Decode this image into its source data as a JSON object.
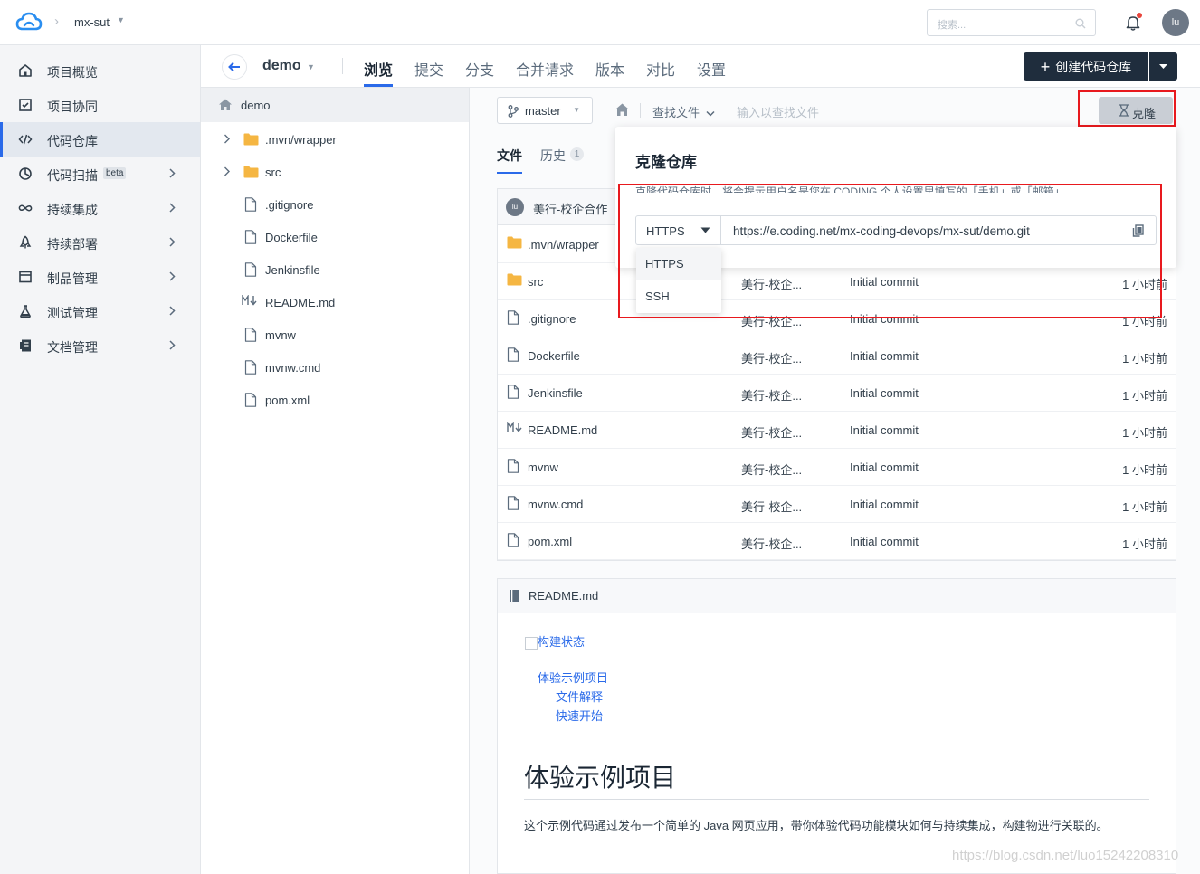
{
  "topbar": {
    "project": "mx-sut",
    "search_placeholder": "搜索...",
    "avatar": "lu"
  },
  "sidebar": {
    "items": [
      {
        "label": "项目概览",
        "icon": "home-icon"
      },
      {
        "label": "项目协同",
        "icon": "checkbox-icon"
      },
      {
        "label": "代码仓库",
        "icon": "code-icon",
        "active": true
      },
      {
        "label": "代码扫描",
        "icon": "scan-icon",
        "badge": "beta"
      },
      {
        "label": "持续集成",
        "icon": "infinity-icon"
      },
      {
        "label": "持续部署",
        "icon": "rocket-icon"
      },
      {
        "label": "制品管理",
        "icon": "box-icon"
      },
      {
        "label": "测试管理",
        "icon": "flask-icon"
      },
      {
        "label": "文档管理",
        "icon": "book-icon"
      }
    ]
  },
  "repo": {
    "name": "demo"
  },
  "tabs": [
    "浏览",
    "提交",
    "分支",
    "合并请求",
    "版本",
    "对比",
    "设置"
  ],
  "create_button": "创建代码仓库",
  "tree": {
    "root": "demo",
    "items": [
      {
        "name": ".mvn/wrapper",
        "type": "folder"
      },
      {
        "name": "src",
        "type": "folder"
      },
      {
        "name": ".gitignore",
        "type": "file"
      },
      {
        "name": "Dockerfile",
        "type": "file"
      },
      {
        "name": "Jenkinsfile",
        "type": "file"
      },
      {
        "name": "README.md",
        "type": "markdown"
      },
      {
        "name": "mvnw",
        "type": "file"
      },
      {
        "name": "mvnw.cmd",
        "type": "file"
      },
      {
        "name": "pom.xml",
        "type": "file"
      }
    ]
  },
  "toolbar": {
    "branch": "master",
    "find_file": "查找文件",
    "find_placeholder": "输入以查找文件",
    "clone": "克隆"
  },
  "file_tabs": {
    "files": "文件",
    "history": "历史",
    "history_count": "1"
  },
  "commit_header": {
    "avatar": "lu",
    "author": "美行-校企合作"
  },
  "files": [
    {
      "name": ".mvn/wrapper",
      "type": "folder",
      "author": "",
      "message": "",
      "time": ""
    },
    {
      "name": "src",
      "type": "folder",
      "author": "美行-校企...",
      "message": "Initial commit",
      "time": "1 小时前"
    },
    {
      "name": ".gitignore",
      "type": "file",
      "author": "美行-校企...",
      "message": "Initial commit",
      "time": "1 小时前"
    },
    {
      "name": "Dockerfile",
      "type": "file",
      "author": "美行-校企...",
      "message": "Initial commit",
      "time": "1 小时前"
    },
    {
      "name": "Jenkinsfile",
      "type": "file",
      "author": "美行-校企...",
      "message": "Initial commit",
      "time": "1 小时前"
    },
    {
      "name": "README.md",
      "type": "markdown",
      "author": "美行-校企...",
      "message": "Initial commit",
      "time": "1 小时前"
    },
    {
      "name": "mvnw",
      "type": "file",
      "author": "美行-校企...",
      "message": "Initial commit",
      "time": "1 小时前"
    },
    {
      "name": "mvnw.cmd",
      "type": "file",
      "author": "美行-校企...",
      "message": "Initial commit",
      "time": "1 小时前"
    },
    {
      "name": "pom.xml",
      "type": "file",
      "author": "美行-校企...",
      "message": "Initial commit",
      "time": "1 小时前"
    }
  ],
  "readme": {
    "filename": "README.md",
    "badge_alt": "构建状态",
    "toc": [
      "体验示例项目",
      "文件解释",
      "快速开始"
    ],
    "heading": "体验示例项目",
    "paragraph": "这个示例代码通过发布一个简单的 Java 网页应用，带你体验代码功能模块如何与持续集成，构建物进行关联的。"
  },
  "clone_popup": {
    "title": "克隆仓库",
    "note": "克隆代码仓库时，将会提示用户名是您在 CODING 个人设置里填写的「手机」或「邮箱」",
    "protocol": "HTTPS",
    "url": "https://e.coding.net/mx-coding-devops/mx-sut/demo.git",
    "options": [
      "HTTPS",
      "SSH"
    ]
  },
  "watermark": "https://blog.csdn.net/luo15242208310",
  "colors": {
    "accent": "#2a6ae9",
    "dark_button": "#1f2d3d",
    "highlight": "#e8191e"
  }
}
